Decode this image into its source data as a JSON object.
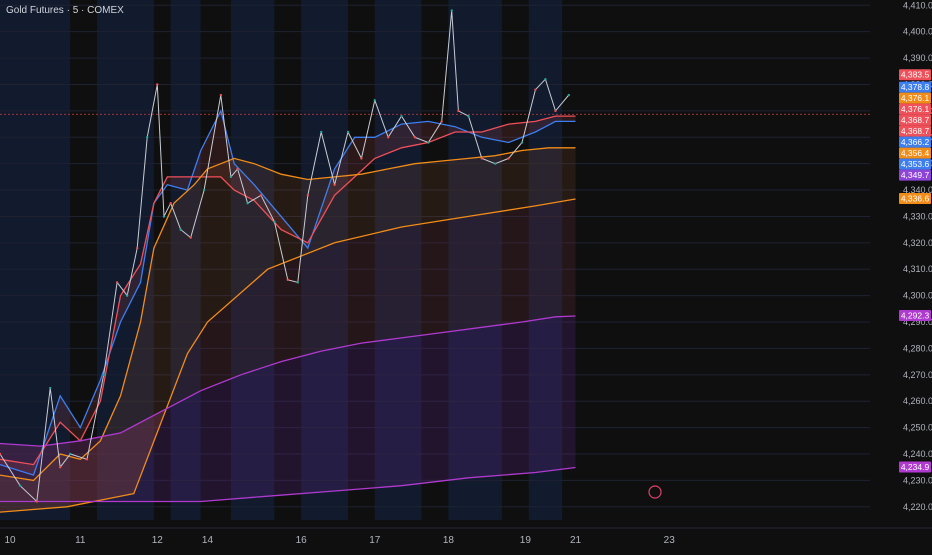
{
  "title": "Gold Futures · 5 · COMEX",
  "chart_data": {
    "type": "line",
    "ylim": [
      4215,
      4412
    ],
    "xlim": [
      0,
      13.0
    ],
    "y_ticks": [
      4220,
      4230,
      4240,
      4250,
      4260,
      4270,
      4280,
      4290,
      4300,
      4310,
      4320,
      4330,
      4340,
      4350,
      4360,
      4370,
      4380,
      4390,
      4400,
      4410
    ],
    "y_tick_labels": [
      "4,220.0",
      "4,230.0",
      "4,240.0",
      "4,250.0",
      "4,260.0",
      "4,270.0",
      "4,280.0",
      "4,290.0",
      "4,300.0",
      "4,310.0",
      "4,320.0",
      "4,330.0",
      "4,340.0",
      "4,350.0",
      "4,360.0",
      "4,370.0",
      "4,380.0",
      "4,390.0",
      "4,400.0",
      "4,410.0"
    ],
    "x_ticks": [
      {
        "label": "10",
        "pos": 0.15
      },
      {
        "label": "11",
        "pos": 1.2
      },
      {
        "label": "12",
        "pos": 2.35
      },
      {
        "label": "14",
        "pos": 3.1
      },
      {
        "label": "16",
        "pos": 4.5
      },
      {
        "label": "17",
        "pos": 5.6
      },
      {
        "label": "18",
        "pos": 6.7
      },
      {
        "label": "19",
        "pos": 7.85
      },
      {
        "label": "21",
        "pos": 8.6
      },
      {
        "label": "23",
        "pos": 10.0
      }
    ],
    "price_labels": [
      {
        "text": "4,383.5",
        "value": 4383.5,
        "color": "#f0505a"
      },
      {
        "text": "4,378.8",
        "value": 4378.8,
        "color": "#3d7ef0"
      },
      {
        "text": "4,376.1",
        "value": 4376.1,
        "color": "#f28c18"
      },
      {
        "text": "4,376.1",
        "value": 4376.1,
        "color": "#f0505a"
      },
      {
        "text": "4,368.7",
        "value": 4368.7,
        "color": "#f0505a"
      },
      {
        "text": "4,368.7",
        "value": 4368.7,
        "color": "#f0505a"
      },
      {
        "text": "4,366.2",
        "value": 4366.2,
        "color": "#3d7ef0"
      },
      {
        "text": "4,356.4",
        "value": 4356.4,
        "color": "#f28c18"
      },
      {
        "text": "4,353.6",
        "value": 4353.6,
        "color": "#3d7ef0"
      },
      {
        "text": "4,349.7",
        "value": 4349.7,
        "color": "#8e44d8"
      },
      {
        "text": "4,336.6",
        "value": 4336.6,
        "color": "#f28c18"
      },
      {
        "text": "4,292.3",
        "value": 4292.3,
        "color": "#b03ad0"
      },
      {
        "text": "4,234.9",
        "value": 4234.9,
        "color": "#b03ad0"
      }
    ],
    "price": {
      "name": "",
      "x": [
        0,
        0.3,
        0.55,
        0.75,
        0.9,
        1.05,
        1.3,
        1.55,
        1.75,
        1.9,
        2.05,
        2.2,
        2.35,
        2.45,
        2.55,
        2.7,
        2.85,
        3.05,
        3.3,
        3.45,
        3.55,
        3.7,
        3.9,
        4.1,
        4.3,
        4.45,
        4.6,
        4.8,
        5.0,
        5.2,
        5.4,
        5.6,
        5.8,
        6.0,
        6.2,
        6.4,
        6.6,
        6.75,
        6.85,
        7.0,
        7.2,
        7.4,
        7.6,
        7.8,
        8.0,
        8.15,
        8.3,
        8.5
      ],
      "values": [
        4240,
        4228,
        4222,
        4265,
        4235,
        4240,
        4238,
        4270,
        4305,
        4300,
        4318,
        4360,
        4380,
        4330,
        4335,
        4325,
        4322,
        4340,
        4376,
        4345,
        4348,
        4335,
        4338,
        4328,
        4306,
        4305,
        4338,
        4362,
        4342,
        4362,
        4352,
        4374,
        4360,
        4368,
        4360,
        4358,
        4366,
        4408,
        4370,
        4368,
        4352,
        4350,
        4352,
        4358,
        4378,
        4382,
        4370,
        4376
      ]
    },
    "series": [
      {
        "color": "#3d7ef0",
        "x": [
          0,
          0.5,
          0.9,
          1.2,
          1.5,
          1.8,
          2.1,
          2.3,
          2.5,
          2.8,
          3.0,
          3.3,
          3.5,
          3.8,
          4.2,
          4.6,
          5.0,
          5.3,
          5.6,
          6.0,
          6.4,
          6.8,
          7.2,
          7.6,
          8.0,
          8.3,
          8.6
        ],
        "values": [
          4236,
          4232,
          4262,
          4250,
          4268,
          4290,
          4305,
          4335,
          4342,
          4340,
          4355,
          4370,
          4350,
          4342,
          4330,
          4318,
          4348,
          4360,
          4360,
          4365,
          4366,
          4364,
          4360,
          4358,
          4362,
          4366,
          4366
        ]
      },
      {
        "color": "#f0505a",
        "x": [
          0,
          0.5,
          0.9,
          1.2,
          1.5,
          1.8,
          2.1,
          2.3,
          2.5,
          2.8,
          3.0,
          3.3,
          3.5,
          3.8,
          4.2,
          4.6,
          5.0,
          5.3,
          5.6,
          6.0,
          6.4,
          6.8,
          7.2,
          7.6,
          8.0,
          8.3,
          8.6
        ],
        "values": [
          4238,
          4236,
          4252,
          4245,
          4260,
          4300,
          4312,
          4335,
          4345,
          4345,
          4345,
          4345,
          4340,
          4336,
          4325,
          4320,
          4338,
          4345,
          4352,
          4356,
          4358,
          4362,
          4362,
          4365,
          4366,
          4368,
          4368
        ]
      },
      {
        "color": "#f28c18",
        "x": [
          0,
          0.5,
          0.9,
          1.2,
          1.5,
          1.8,
          2.1,
          2.3,
          2.6,
          2.9,
          3.1,
          3.3,
          3.5,
          3.8,
          4.2,
          4.6,
          5.0,
          5.4,
          5.8,
          6.2,
          6.6,
          7.0,
          7.4,
          7.8,
          8.2,
          8.6
        ],
        "values": [
          4232,
          4230,
          4240,
          4238,
          4245,
          4262,
          4290,
          4318,
          4335,
          4342,
          4348,
          4350,
          4352,
          4350,
          4346,
          4344,
          4345,
          4346,
          4348,
          4350,
          4351,
          4352,
          4353,
          4355,
          4356,
          4356
        ]
      },
      {
        "color": "#f28c18",
        "x": [
          0,
          1.0,
          2.0,
          2.8,
          3.1,
          4.0,
          5.0,
          6.0,
          7.0,
          8.0,
          8.6
        ],
        "values": [
          4218,
          4220,
          4225,
          4278,
          4290,
          4310,
          4320,
          4326,
          4330,
          4334,
          4336.6
        ]
      },
      {
        "color": "#b03ad0",
        "x": [
          0,
          0.6,
          1.2,
          1.8,
          2.4,
          3.0,
          3.6,
          4.2,
          4.8,
          5.4,
          6.0,
          6.6,
          7.2,
          7.8,
          8.3,
          8.6
        ],
        "values": [
          4244,
          4243,
          4245,
          4248,
          4256,
          4264,
          4270,
          4275,
          4279,
          4282,
          4284,
          4286,
          4288,
          4290,
          4292,
          4292.3
        ]
      },
      {
        "color": "#b03ad0",
        "x": [
          0,
          1.0,
          2.0,
          3.0,
          4.0,
          5.0,
          6.0,
          7.0,
          8.0,
          8.6
        ],
        "values": [
          4222,
          4222,
          4222,
          4222,
          4224,
          4226,
          4228,
          4231,
          4233,
          4234.9
        ]
      }
    ]
  }
}
